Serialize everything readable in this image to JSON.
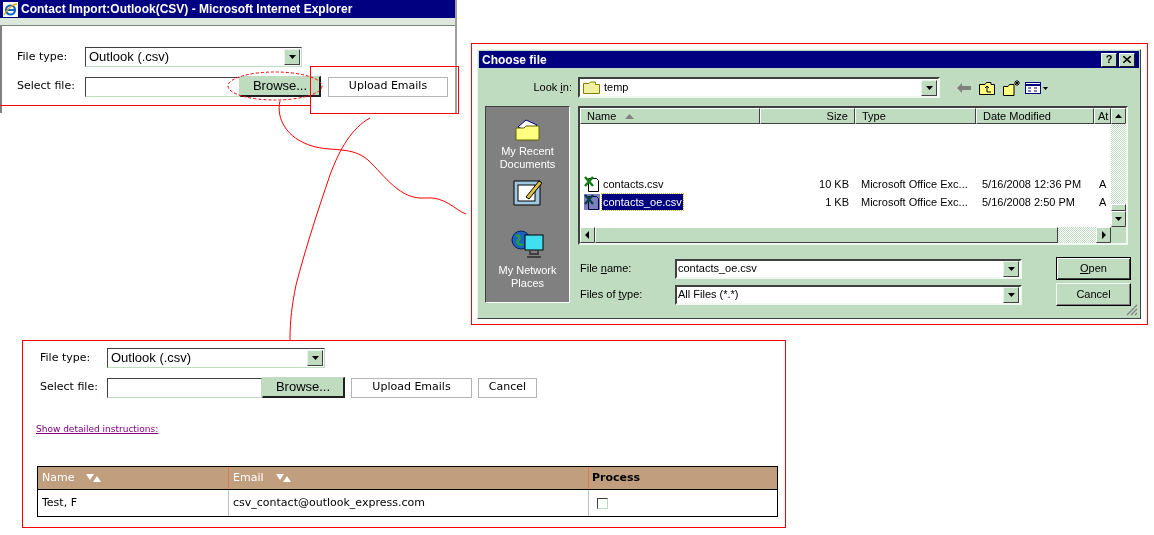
{
  "browser_window": {
    "title": "Contact Import:Outlook(CSV) - Microsoft Internet Explorer",
    "file_type": {
      "label": "File type:",
      "value": "Outlook (.csv)"
    },
    "select_file": {
      "label": "Select file:"
    },
    "buttons": [
      {
        "label": "Browse...",
        "kind": "browse"
      },
      {
        "label": "Upload Emails",
        "kind": "plain"
      }
    ]
  },
  "file_dialog": {
    "title": "Choose file",
    "title_buttons": [
      {
        "kind": "help",
        "label": "?"
      },
      {
        "kind": "close"
      }
    ],
    "look_in": {
      "label_parts": [
        {
          "text": "Look ",
          "underlined": false
        },
        {
          "text": "i",
          "underlined": true
        },
        {
          "text": "n:",
          "underlined": false
        }
      ],
      "value": "temp"
    },
    "places": [
      {
        "kind": "recent",
        "label": "My Recent Documents"
      },
      {
        "kind": "desktop"
      },
      {
        "kind": "network",
        "label": "My Network Places"
      }
    ],
    "columns": [
      {
        "label": "Name",
        "sorted": true
      },
      {
        "label": "Size",
        "sorted": false
      },
      {
        "label": "Type",
        "sorted": false
      },
      {
        "label": "Date Modified",
        "sorted": false
      },
      {
        "label": "At",
        "sorted": false
      }
    ],
    "rows": [
      {
        "cells": [
          "contacts.csv",
          "10 KB",
          "Microsoft Office Exc...",
          "5/16/2008 12:36 PM",
          "A"
        ],
        "selected": false
      },
      {
        "cells": [
          "contacts_oe.csv",
          "1 KB",
          "Microsoft Office Exc...",
          "5/16/2008 2:50 PM",
          "A"
        ],
        "selected": true
      }
    ],
    "file_name": {
      "label_parts": [
        {
          "text": "File ",
          "underlined": false
        },
        {
          "text": "n",
          "underlined": true
        },
        {
          "text": "ame:",
          "underlined": false
        }
      ],
      "value": "contacts_oe.csv"
    },
    "files_of_type": {
      "label_parts": [
        {
          "text": "Files of ",
          "underlined": false
        },
        {
          "text": "t",
          "underlined": true
        },
        {
          "text": "ype:",
          "underlined": false
        }
      ],
      "value": "All Files (*.*)"
    },
    "buttons": [
      {
        "label_parts": [
          {
            "text": "O",
            "underlined": true
          },
          {
            "text": "pen",
            "underlined": false
          }
        ],
        "default": true
      },
      {
        "label_parts": [
          {
            "text": "Cancel",
            "underlined": false
          }
        ],
        "default": false
      }
    ]
  },
  "import_form": {
    "file_type": {
      "label": "File type:",
      "value": "Outlook (.csv)"
    },
    "select_file": {
      "label": "Select file:"
    },
    "buttons": [
      {
        "label": "Browse...",
        "kind": "browse"
      },
      {
        "label": "Upload Emails",
        "kind": "plain"
      },
      {
        "label": "Cancel",
        "kind": "plain"
      }
    ],
    "instructions_link": "Show detailed instructions:",
    "table": {
      "columns": [
        {
          "label": "Name",
          "sortable": true
        },
        {
          "label": "Email",
          "sortable": true
        },
        {
          "label": "Process",
          "sortable": false
        }
      ],
      "rows": [
        {
          "name": "Test, F",
          "email": "csv_contact@outlook_express.com",
          "checked": false
        }
      ]
    }
  }
}
